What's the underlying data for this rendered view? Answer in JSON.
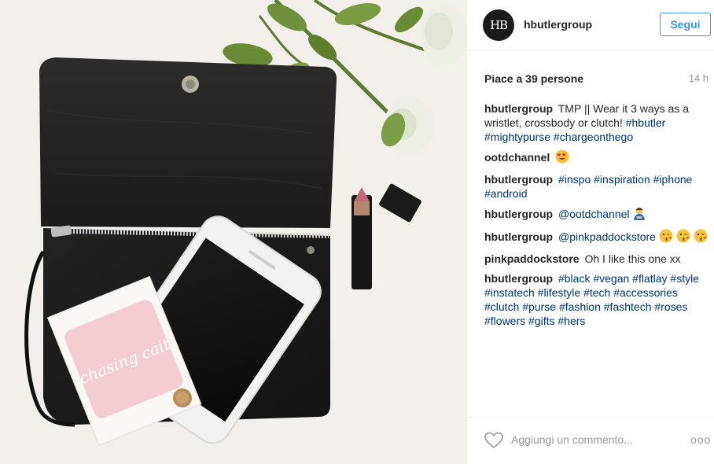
{
  "post": {
    "username": "hbutlergroup",
    "avatar_initials": "HB",
    "follow_label": "Segui",
    "likes_text": "Piace a 39 persone",
    "time_ago": "14 h"
  },
  "comments": [
    {
      "author": "hbutlergroup",
      "text": "TMP || Wear it 3 ways as a wristlet, crossbody or clutch!",
      "tags": "#hbutler #mightypurse #chargeonthego"
    },
    {
      "author": "ootdchannel",
      "text": "",
      "tags": "",
      "emoji": "heart-eyes"
    },
    {
      "author": "hbutlergroup",
      "text": "",
      "tags": "#inspo #inspiration #iphone #android"
    },
    {
      "author": "hbutlergroup",
      "text": "",
      "tags": "@ootdchannel",
      "emoji": "person-bowing"
    },
    {
      "author": "hbutlergroup",
      "text": "",
      "tags": "@pinkpaddockstore",
      "emoji": "kissing-faces"
    },
    {
      "author": "pinkpaddockstore",
      "text": "Oh I like this one xx",
      "tags": ""
    },
    {
      "author": "hbutlergroup",
      "text": "",
      "tags": "#black #vegan #flatlay #style #instatech #lifestyle #tech #accessories #clutch #purse #fashion #fashtech #roses #flowers #gifts #hers"
    }
  ],
  "footer": {
    "comment_placeholder": "Aggiungi un commento...",
    "more_label": "ooo"
  },
  "photo": {
    "card_text": "chasing cait"
  },
  "colors": {
    "accent": "#3897f0",
    "hashtag": "#003569",
    "muted": "#999999"
  }
}
